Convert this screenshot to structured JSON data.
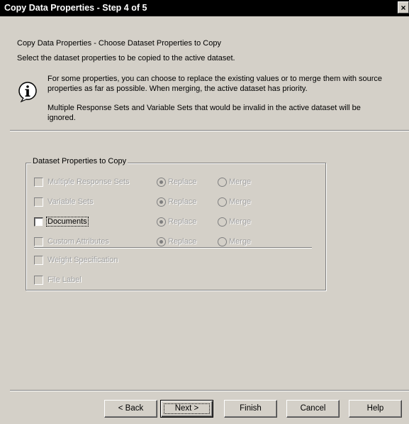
{
  "window": {
    "title": "Copy Data Properties - Step 4 of 5",
    "close_glyph": "×"
  },
  "header": {
    "heading": "Copy Data Properties - Choose Dataset Properties to Copy",
    "subheading": "Select the dataset properties to be copied to the active dataset.",
    "info_line1": "For some properties, you can choose to replace the existing values or to merge them with source",
    "info_line2": "properties as far as possible.  When merging, the active dataset has priority.",
    "info_line3": "Multiple Response Sets and Variable Sets that would be invalid in the active dataset will be",
    "info_line4": "ignored."
  },
  "group": {
    "label": "Dataset Properties to Copy",
    "replace_label": "Replace",
    "merge_label": "Merge",
    "items": [
      {
        "label": "Multiple Response Sets",
        "enabled": false,
        "checked": false,
        "selected": "Replace"
      },
      {
        "label": "Variable Sets",
        "enabled": false,
        "checked": false,
        "selected": "Replace"
      },
      {
        "label": "Documents",
        "enabled": true,
        "checked": false,
        "selected": "Replace"
      },
      {
        "label": "Custom Attributes",
        "enabled": false,
        "checked": false,
        "selected": "Replace"
      },
      {
        "label": "Weight Specification",
        "enabled": false,
        "checked": false
      },
      {
        "label": "File Label",
        "enabled": false,
        "checked": false
      }
    ]
  },
  "buttons": {
    "back": "< Back",
    "next": "Next >",
    "finish": "Finish",
    "cancel": "Cancel",
    "help": "Help"
  },
  "colors": {
    "dialog_bg": "#d4d0c8",
    "titlebar_bg": "#000000",
    "disabled_text": "#a0a0a0"
  },
  "icons": {
    "info": "info-icon",
    "close": "close-icon"
  }
}
